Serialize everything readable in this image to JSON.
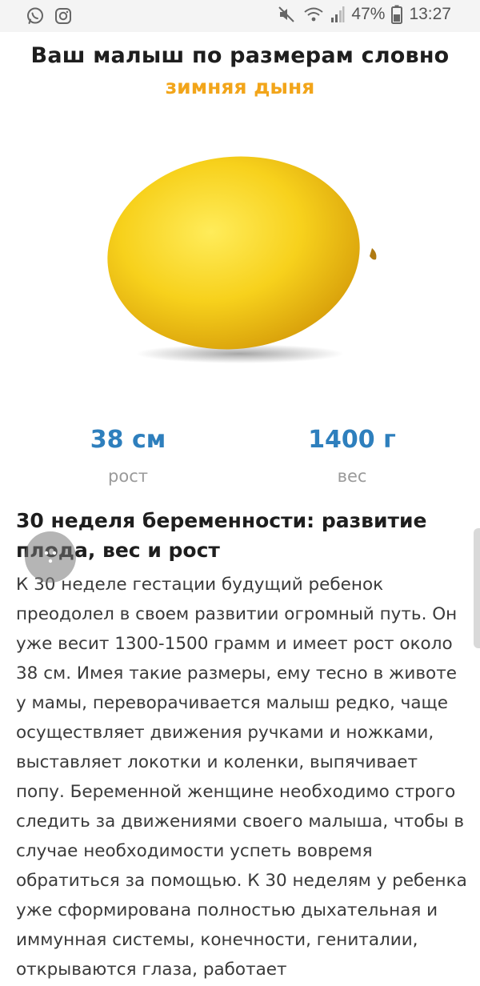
{
  "status_bar": {
    "battery_percent": "47%",
    "time": "13:27",
    "icons": [
      "whatsapp-icon",
      "instagram-icon",
      "mute-icon",
      "wifi-icon",
      "signal-icon",
      "battery-icon"
    ]
  },
  "header": {
    "title": "Ваш малыш по размерам словно",
    "subtitle": "зимняя дыня",
    "subtitle_color": "#f2a51a"
  },
  "image": {
    "subject": "yellow melon"
  },
  "stats": {
    "height": {
      "value": "38 см",
      "label": "рост"
    },
    "weight": {
      "value": "1400 г",
      "label": "вес"
    },
    "value_color": "#2e7fbd"
  },
  "article": {
    "title": "30 неделя беременности: развитие плода, вес и рост",
    "body": "К 30 неделе гестации будущий ребенок преодолел в своем развитии огромный путь. Он уже весит 1300-1500 грамм и имеет рост около 38 см. Имея такие размеры, ему тесно в животе у мамы, переворачивается малыш редко, чаще осуществляет движения ручками и ножками, выставляет локотки и коленки, выпячивает попу. Беременной женщине необходимо строго следить за движениями своего малыша, чтобы в случае необходимости успеть вовремя обратиться за помощью. К 30 неделям у ребенка уже сформирована полностью дыхательная и иммунная системы, конечности, гениталии, открываются глаза, работает"
  }
}
